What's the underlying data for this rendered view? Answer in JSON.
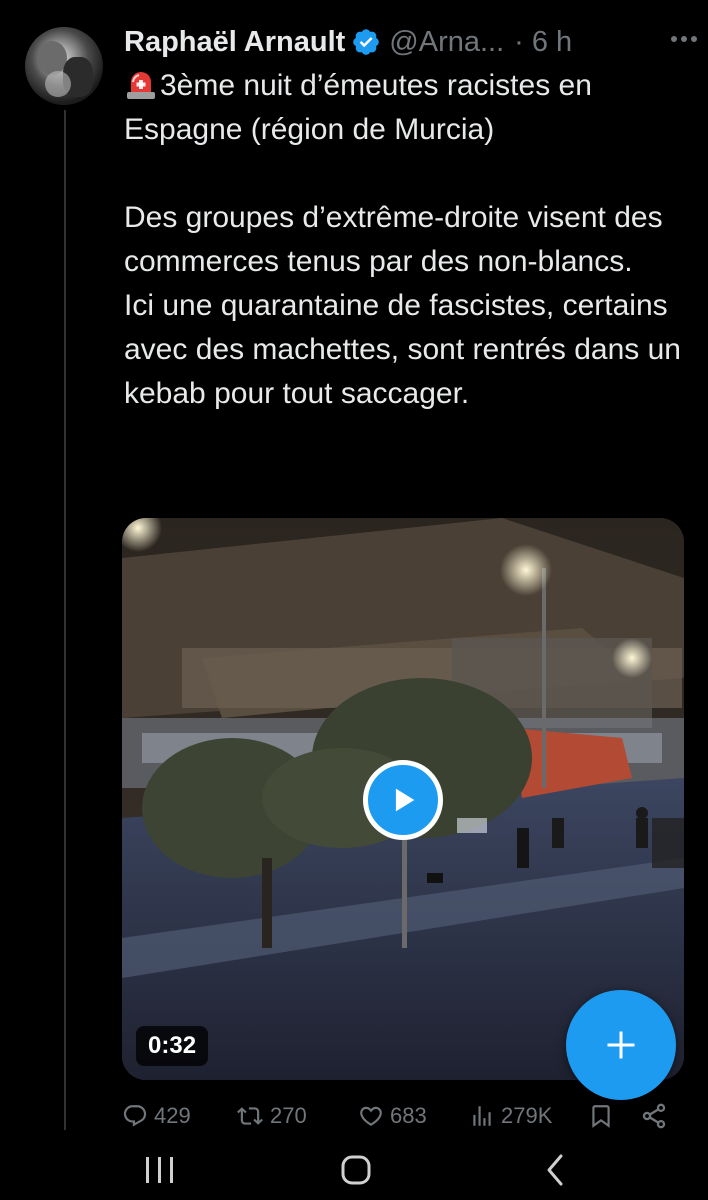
{
  "tweet": {
    "author_name": "Raphaël Arnault",
    "handle": "@Arna...",
    "separator": "·",
    "time": "6 h",
    "text": "3ème nuit d’émeutes racistes en Espagne (région de Murcia)\n\nDes groupes d’extrême-droite visent des commerces tenus par des non-blancs.\nIci une quarantaine de fascistes, certains avec des machettes, sont rentrés dans un kebab pour tout saccager.",
    "media": {
      "duration": "0:32"
    }
  },
  "actions": {
    "replies": "429",
    "retweets": "270",
    "likes": "683",
    "views": "279K"
  },
  "icons": {
    "verified": "verified-badge-icon",
    "siren": "rotating-light-emoji",
    "reply": "reply-icon",
    "retweet": "retweet-icon",
    "like": "heart-icon",
    "views": "analytics-icon",
    "bookmark": "bookmark-icon",
    "share": "share-icon",
    "compose": "plus-icon"
  },
  "colors": {
    "accent": "#1d9bf0",
    "text": "#e7e9ea",
    "muted": "#71767b",
    "background": "#000000"
  }
}
